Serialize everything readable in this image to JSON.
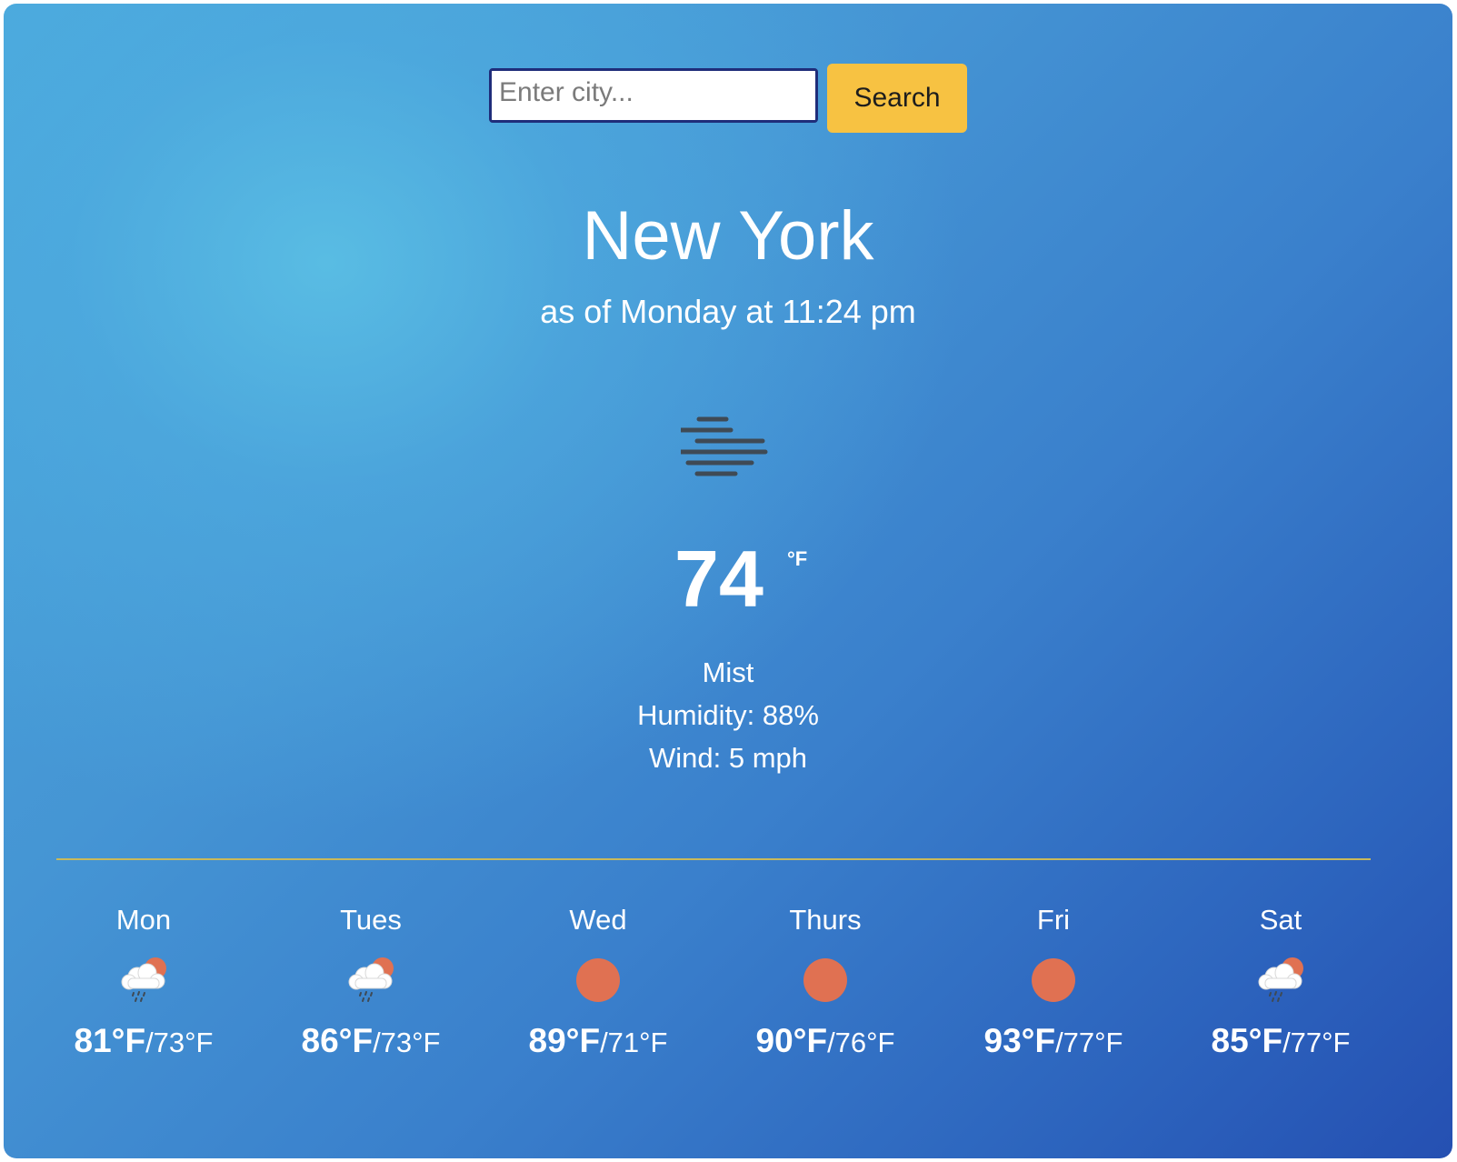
{
  "search": {
    "placeholder": "Enter city...",
    "button_label": "Search"
  },
  "current": {
    "city": "New York",
    "as_of": "as of Monday at 11:24 pm",
    "icon": "mist-icon",
    "temperature": "74",
    "unit": "°F",
    "condition": "Mist",
    "humidity": "Humidity: 88%",
    "wind": "Wind: 5 mph"
  },
  "forecast": [
    {
      "day": "Mon",
      "icon": "rain-cloud-sun-icon",
      "high": "81°F",
      "low": "/73°F"
    },
    {
      "day": "Tues",
      "icon": "rain-cloud-sun-icon",
      "high": "86°F",
      "low": "/73°F"
    },
    {
      "day": "Wed",
      "icon": "sun-icon",
      "high": "89°F",
      "low": "/71°F"
    },
    {
      "day": "Thurs",
      "icon": "sun-icon",
      "high": "90°F",
      "low": "/76°F"
    },
    {
      "day": "Fri",
      "icon": "sun-icon",
      "high": "93°F",
      "low": "/77°F"
    },
    {
      "day": "Sat",
      "icon": "rain-cloud-sun-icon",
      "high": "85°F",
      "low": "/77°F"
    }
  ],
  "colors": {
    "accent_button": "#f7c242",
    "sun": "#e07152",
    "divider": "#c9b95b"
  }
}
